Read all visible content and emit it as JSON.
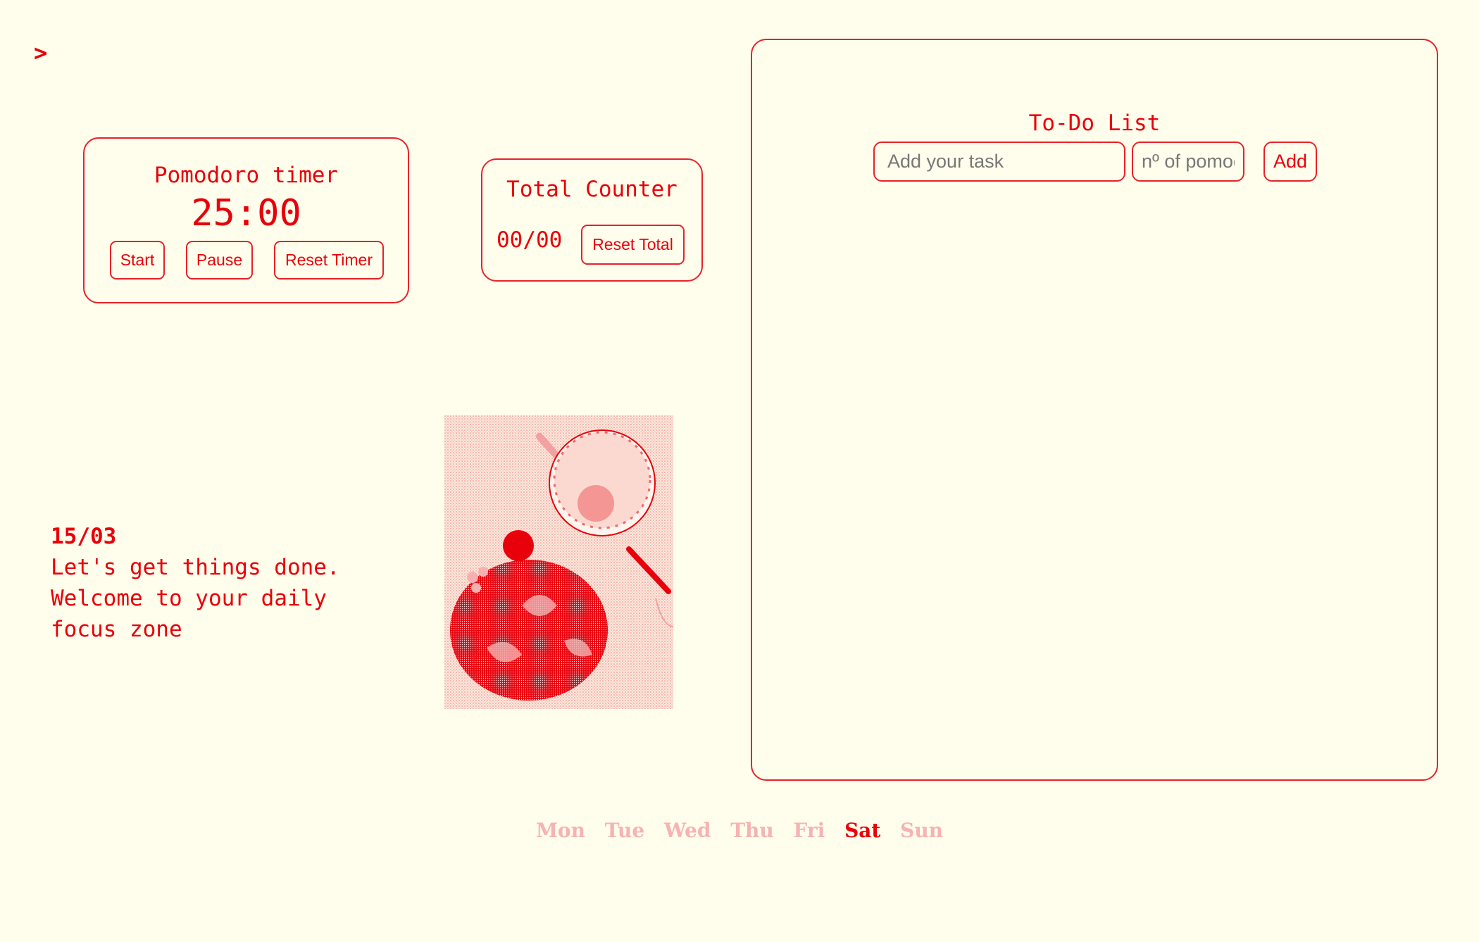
{
  "sidebar_toggle": {
    "icon": "chevron-right-icon",
    "label": ">"
  },
  "pomodoro": {
    "title": "Pomodoro timer",
    "time": "25:00",
    "buttons": {
      "start": "Start",
      "pause": "Pause",
      "reset": "Reset Timer"
    }
  },
  "counter": {
    "title": "Total Counter",
    "value": "00/00",
    "reset": "Reset Total"
  },
  "todo": {
    "title": "To-Do List",
    "task_placeholder": "Add your task",
    "task_value": "",
    "pomodoros_placeholder": "nº of pomodoros",
    "pomodoros_value": "",
    "add": "Add"
  },
  "greeting": {
    "date": "15/03",
    "lines": [
      "Let's get things done.",
      "Welcome to your daily",
      "focus zone"
    ]
  },
  "days": {
    "items": [
      "Mon",
      "Tue",
      "Wed",
      "Thu",
      "Fri",
      "Sat",
      "Sun"
    ],
    "active": "Sat"
  },
  "colors": {
    "background": "#fffdeb",
    "accent": "#e8000b",
    "inactive_day": "#f5b3b3"
  }
}
